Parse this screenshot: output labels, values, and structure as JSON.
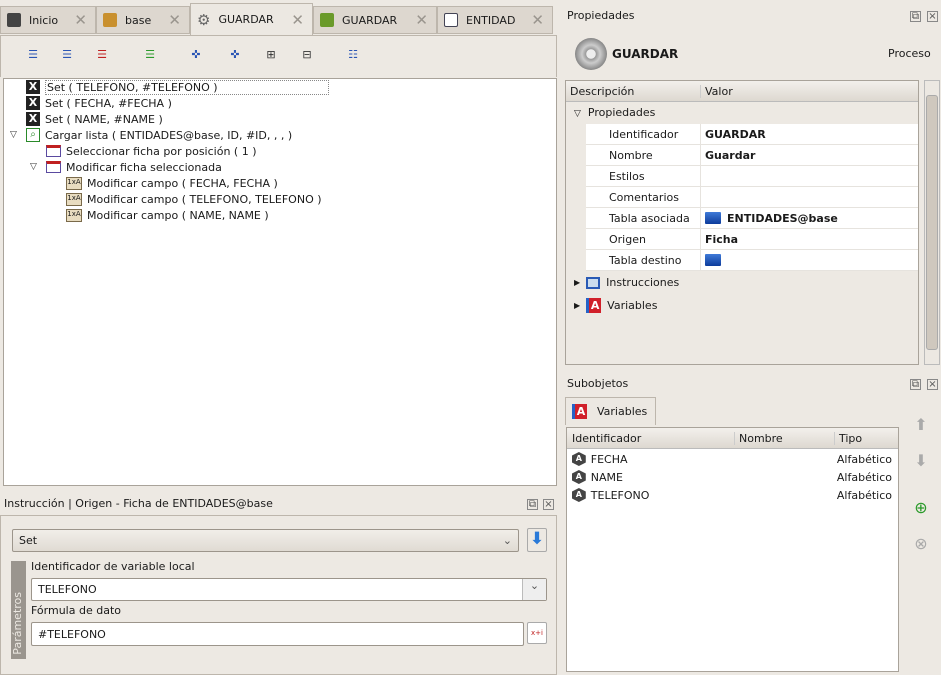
{
  "tabs": [
    {
      "label": "Inicio",
      "icon": "start-icon"
    },
    {
      "label": "base",
      "icon": "database-icon"
    },
    {
      "label": "GUARDAR",
      "icon": "gear-icon",
      "active": true
    },
    {
      "label": "GUARDAR",
      "icon": "green-gear-icon"
    },
    {
      "label": "ENTIDAD",
      "icon": "form-icon"
    }
  ],
  "toolbar": [
    "insert-after-icon",
    "insert-before-icon",
    "delete-line-icon",
    "comment-icon",
    "expand-all-icon",
    "collapse-all-icon",
    "expand-icon",
    "collapse-icon",
    "tree-view-icon"
  ],
  "tree": [
    {
      "label": "Set ( TELEFONO, #TELEFONO )",
      "level": 0,
      "icon": "set-icon"
    },
    {
      "label": "Set ( FECHA, #FECHA )",
      "level": 0,
      "icon": "set-icon"
    },
    {
      "label": "Set ( NAME, #NAME )",
      "level": 0,
      "icon": "set-icon"
    },
    {
      "label": "Cargar lista ( ENTIDADES@base, ID, #ID, , ,  )",
      "level": 0,
      "icon": "search-icon",
      "expanded": true
    },
    {
      "label": "Seleccionar ficha por posición ( 1 )",
      "level": 1,
      "icon": "record-icon"
    },
    {
      "label": "Modificar ficha seleccionada",
      "level": 1,
      "icon": "record-icon",
      "expanded": true
    },
    {
      "label": "Modificar campo ( FECHA, FECHA )",
      "level": 2,
      "icon": "field-icon"
    },
    {
      "label": "Modificar campo ( TELEFONO, TELEFONO )",
      "level": 2,
      "icon": "field-icon"
    },
    {
      "label": "Modificar campo ( NAME, NAME )",
      "level": 2,
      "icon": "field-icon"
    }
  ],
  "instr": {
    "title": "Instrucción | Origen - Ficha de ENTIDADES@base",
    "command": "Set",
    "side_label": "Parámetros",
    "var_label": "Identificador de variable local",
    "var_value": "TELEFONO",
    "formula_label": "Fórmula de dato",
    "formula_value": "#TELEFONO",
    "formula_btn": "x+i"
  },
  "props": {
    "title": "Propiedades",
    "name": "GUARDAR",
    "type": "Proceso",
    "col_desc": "Descripción",
    "col_val": "Valor",
    "group": "Propiedades",
    "rows": [
      {
        "d": "Identificador",
        "v": "GUARDAR"
      },
      {
        "d": "Nombre",
        "v": "Guardar"
      },
      {
        "d": "Estilos",
        "v": ""
      },
      {
        "d": "Comentarios",
        "v": ""
      },
      {
        "d": "Tabla asociada",
        "v": "ENTIDADES@base"
      },
      {
        "d": "Origen",
        "v": "Ficha"
      },
      {
        "d": "Tabla destino",
        "v": ""
      }
    ],
    "instrucciones": "Instrucciones",
    "variables": "Variables"
  },
  "sub": {
    "title": "Subobjetos",
    "tab": "Variables",
    "cols": [
      "Identificador",
      "Nombre",
      "Tipo"
    ],
    "rows": [
      {
        "id": "FECHA",
        "nombre": "",
        "tipo": "Alfabético"
      },
      {
        "id": "NAME",
        "nombre": "",
        "tipo": "Alfabético"
      },
      {
        "id": "TELEFONO",
        "nombre": "",
        "tipo": "Alfabético"
      }
    ]
  }
}
